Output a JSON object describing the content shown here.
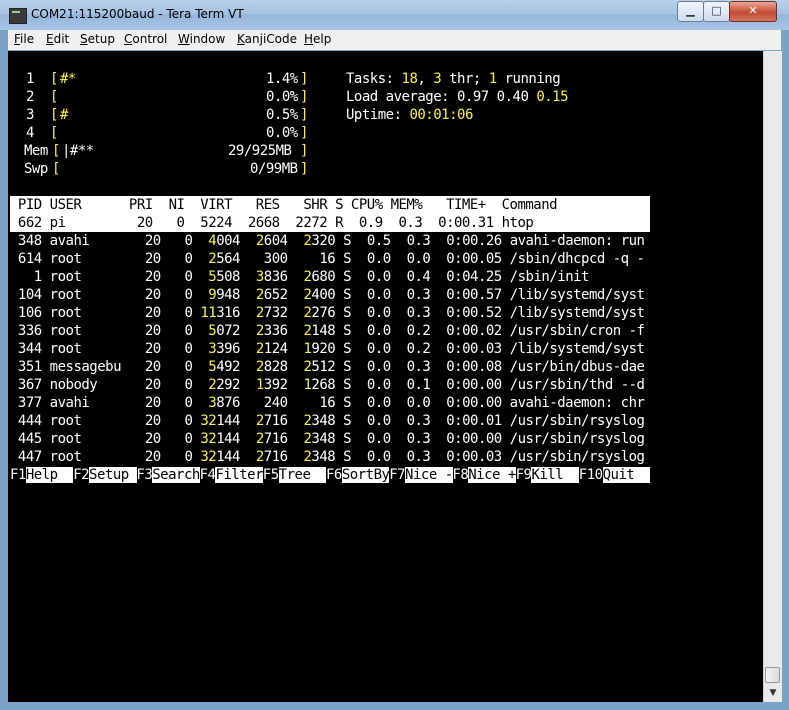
{
  "window": {
    "title": "COM21:115200baud - Tera Term VT",
    "min": "▁",
    "max": "□",
    "close": "✕"
  },
  "menu": [
    "File",
    "Edit",
    "Setup",
    "Control",
    "Window",
    "KanjiCode",
    "Help"
  ],
  "meters": {
    "cpu1": {
      "num": "1",
      "bar": "#*",
      "pct": "1.4%"
    },
    "cpu2": {
      "num": "2",
      "bar": "",
      "pct": "0.0%"
    },
    "cpu3": {
      "num": "3",
      "bar": "#",
      "pct": "0.5%"
    },
    "cpu4": {
      "num": "4",
      "bar": "",
      "pct": "0.0%"
    },
    "mem": {
      "label": "Mem",
      "bar": "|#**",
      "val": "29/925MB"
    },
    "swp": {
      "label": "Swp",
      "bar": "",
      "val": "0/99MB"
    }
  },
  "stats": {
    "tasks_label": "Tasks: ",
    "tasks": "18",
    "comma": ", ",
    "thr": "3",
    "thr_label": " thr; ",
    "running": "1",
    "running_label": " running",
    "load_label": "Load average: ",
    "load1": "0.97",
    "load5": "0.40",
    "load15": "0.15",
    "uptime_label": "Uptime: ",
    "uptime": "00:01:06"
  },
  "table": {
    "header": " PID USER      PRI  NI  VIRT   RES   SHR S CPU% MEM%   TIME+  Command",
    "selected": " 662 pi         20   0  5224  2668  2272 R  0.9  0.3  0:00.31 htop",
    "rows": [
      {
        "pid": " 348",
        "user": "avahi    ",
        "pri": "20",
        "ni": "0",
        "v1": "4",
        "v2": "004",
        "r1": "2",
        "r2": "604",
        "s1": "2",
        "s2": "320",
        "st": "S",
        "cpu": "0.5",
        "mem": "0.3",
        "time": "0:00.26",
        "cmd": "avahi-daemon: run"
      },
      {
        "pid": " 614",
        "user": "root     ",
        "pri": "20",
        "ni": "0",
        "v1": "2",
        "v2": "564",
        "r1": "",
        "r2": "300",
        "s1": "",
        "s2": "16",
        "st": "S",
        "cpu": "0.0",
        "mem": "0.0",
        "time": "0:00.05",
        "cmd": "/sbin/dhcpcd -q -"
      },
      {
        "pid": "   1",
        "user": "root     ",
        "pri": "20",
        "ni": "0",
        "v1": "5",
        "v2": "508",
        "r1": "3",
        "r2": "836",
        "s1": "2",
        "s2": "680",
        "st": "S",
        "cpu": "0.0",
        "mem": "0.4",
        "time": "0:04.25",
        "cmd": "/sbin/init"
      },
      {
        "pid": " 104",
        "user": "root     ",
        "pri": "20",
        "ni": "0",
        "v1": "9",
        "v2": "948",
        "r1": "2",
        "r2": "652",
        "s1": "2",
        "s2": "400",
        "st": "S",
        "cpu": "0.0",
        "mem": "0.3",
        "time": "0:00.57",
        "cmd": "/lib/systemd/syst"
      },
      {
        "pid": " 106",
        "user": "root     ",
        "pri": "20",
        "ni": "0",
        "v1": "11",
        "v2": "316",
        "r1": "2",
        "r2": "732",
        "s1": "2",
        "s2": "276",
        "st": "S",
        "cpu": "0.0",
        "mem": "0.3",
        "time": "0:00.52",
        "cmd": "/lib/systemd/syst"
      },
      {
        "pid": " 336",
        "user": "root     ",
        "pri": "20",
        "ni": "0",
        "v1": "5",
        "v2": "072",
        "r1": "2",
        "r2": "336",
        "s1": "2",
        "s2": "148",
        "st": "S",
        "cpu": "0.0",
        "mem": "0.2",
        "time": "0:00.02",
        "cmd": "/usr/sbin/cron -f"
      },
      {
        "pid": " 344",
        "user": "root     ",
        "pri": "20",
        "ni": "0",
        "v1": "3",
        "v2": "396",
        "r1": "2",
        "r2": "124",
        "s1": "1",
        "s2": "920",
        "st": "S",
        "cpu": "0.0",
        "mem": "0.2",
        "time": "0:00.03",
        "cmd": "/lib/systemd/syst"
      },
      {
        "pid": " 351",
        "user": "messagebu",
        "pri": "20",
        "ni": "0",
        "v1": "5",
        "v2": "492",
        "r1": "2",
        "r2": "828",
        "s1": "2",
        "s2": "512",
        "st": "S",
        "cpu": "0.0",
        "mem": "0.3",
        "time": "0:00.08",
        "cmd": "/usr/bin/dbus-dae"
      },
      {
        "pid": " 367",
        "user": "nobody   ",
        "pri": "20",
        "ni": "0",
        "v1": "2",
        "v2": "292",
        "r1": "1",
        "r2": "392",
        "s1": "1",
        "s2": "268",
        "st": "S",
        "cpu": "0.0",
        "mem": "0.1",
        "time": "0:00.00",
        "cmd": "/usr/sbin/thd --d"
      },
      {
        "pid": " 377",
        "user": "avahi    ",
        "pri": "20",
        "ni": "0",
        "v1": "3",
        "v2": "876",
        "r1": "",
        "r2": "240",
        "s1": "",
        "s2": "16",
        "st": "S",
        "cpu": "0.0",
        "mem": "0.0",
        "time": "0:00.00",
        "cmd": "avahi-daemon: chr"
      },
      {
        "pid": " 444",
        "user": "root     ",
        "pri": "20",
        "ni": "0",
        "v1": "32",
        "v2": "144",
        "r1": "2",
        "r2": "716",
        "s1": "2",
        "s2": "348",
        "st": "S",
        "cpu": "0.0",
        "mem": "0.3",
        "time": "0:00.01",
        "cmd": "/usr/sbin/rsyslog"
      },
      {
        "pid": " 445",
        "user": "root     ",
        "pri": "20",
        "ni": "0",
        "v1": "32",
        "v2": "144",
        "r1": "2",
        "r2": "716",
        "s1": "2",
        "s2": "348",
        "st": "S",
        "cpu": "0.0",
        "mem": "0.3",
        "time": "0:00.00",
        "cmd": "/usr/sbin/rsyslog"
      },
      {
        "pid": " 447",
        "user": "root     ",
        "pri": "20",
        "ni": "0",
        "v1": "32",
        "v2": "144",
        "r1": "2",
        "r2": "716",
        "s1": "2",
        "s2": "348",
        "st": "S",
        "cpu": "0.0",
        "mem": "0.3",
        "time": "0:00.03",
        "cmd": "/usr/sbin/rsyslog"
      }
    ]
  },
  "fkeys": [
    {
      "key": "F1",
      "label": "Help  "
    },
    {
      "key": "F2",
      "label": "Setup "
    },
    {
      "key": "F3",
      "label": "Search"
    },
    {
      "key": "F4",
      "label": "Filter"
    },
    {
      "key": "F5",
      "label": "Tree  "
    },
    {
      "key": "F6",
      "label": "SortBy"
    },
    {
      "key": "F7",
      "label": "Nice -"
    },
    {
      "key": "F8",
      "label": "Nice +"
    },
    {
      "key": "F9",
      "label": "Kill  "
    },
    {
      "key": "F10",
      "label": "Quit  "
    }
  ]
}
